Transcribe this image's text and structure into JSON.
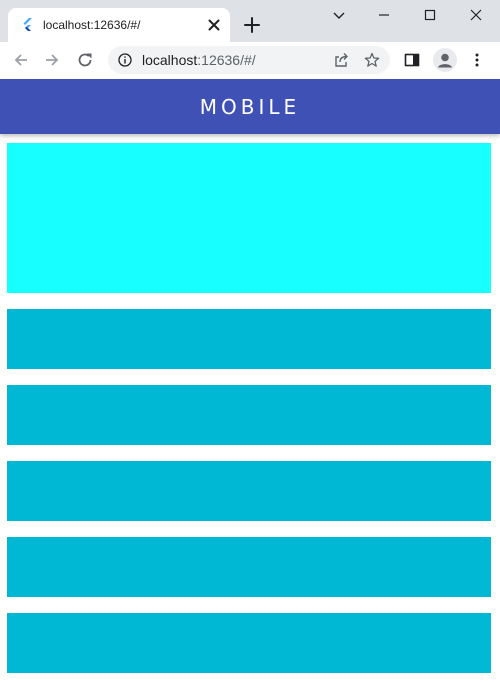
{
  "browser": {
    "tab_title": "localhost:12636/#/",
    "url_host": "localhost",
    "url_rest": ":12636/#/"
  },
  "app": {
    "title": "MOBILE",
    "colors": {
      "appbar": "#3f51b5",
      "hero": "#18ffff",
      "tile": "#00b8d4"
    },
    "tiles": [
      "tile-1",
      "tile-2",
      "tile-3",
      "tile-4",
      "tile-5"
    ]
  },
  "icons": {
    "favicon": "flutter-icon",
    "tab_close": "close-icon",
    "new_tab": "plus-icon",
    "back": "arrow-left-icon",
    "forward": "arrow-right-icon",
    "reload": "reload-icon",
    "site_info": "info-icon",
    "share": "share-icon",
    "bookmark": "star-icon",
    "side_panel": "side-panel-icon",
    "profile": "avatar-icon",
    "menu": "kebab-menu-icon",
    "tab_search": "chevron-down-icon",
    "minimize": "minimize-icon",
    "maximize": "maximize-icon",
    "close_window": "close-window-icon"
  }
}
